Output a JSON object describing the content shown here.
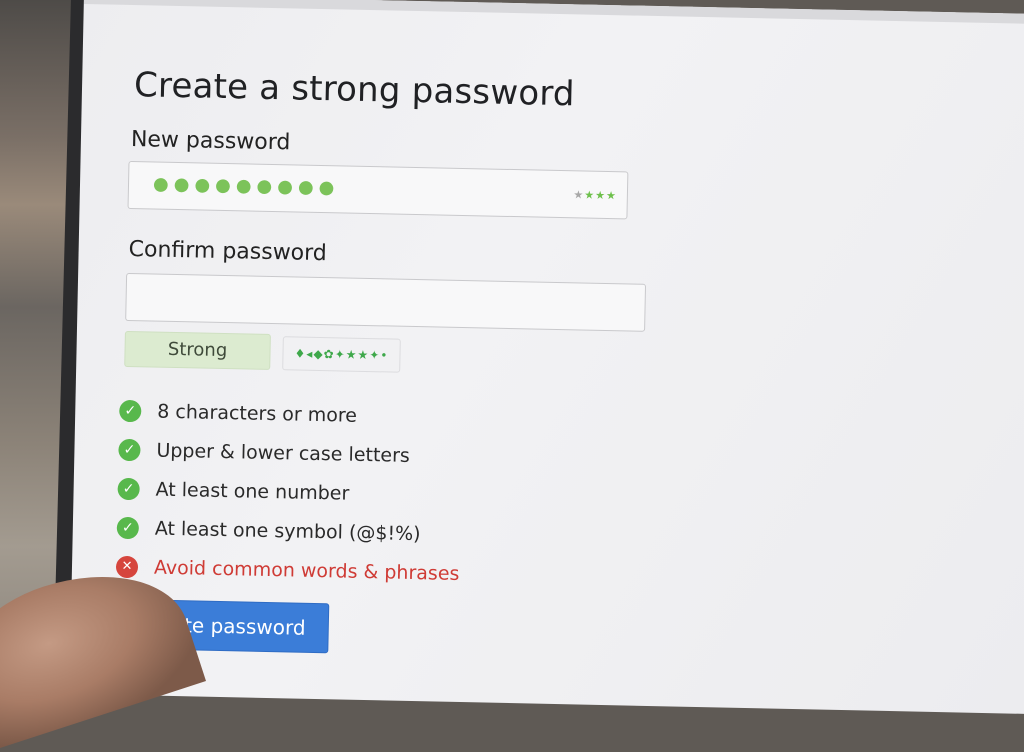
{
  "form": {
    "title": "Create a strong password",
    "new_password_label": "New password",
    "new_password_value": "●●●●●●●●●",
    "confirm_password_label": "Confirm password",
    "confirm_password_value": ""
  },
  "strength": {
    "label": "Strong",
    "stars_total": 4,
    "stars_filled": 3,
    "meter_glyphs": "♦◂◆✿✦★★✦•"
  },
  "requirements": [
    {
      "text": "8 characters or more",
      "met": true
    },
    {
      "text": "Upper & lower case letters",
      "met": true
    },
    {
      "text": "At least one number",
      "met": true
    },
    {
      "text": "At least one symbol (@$!%)",
      "met": true
    },
    {
      "text": "Avoid common words & phrases",
      "met": false
    }
  ],
  "submit_label": "Create password",
  "icons": {
    "ok": "check-circle-icon",
    "fail": "x-circle-icon"
  },
  "colors": {
    "accent": "#3b7dd8",
    "success": "#58b84c",
    "error": "#d6453d",
    "password_dots": "#7cc35a"
  }
}
